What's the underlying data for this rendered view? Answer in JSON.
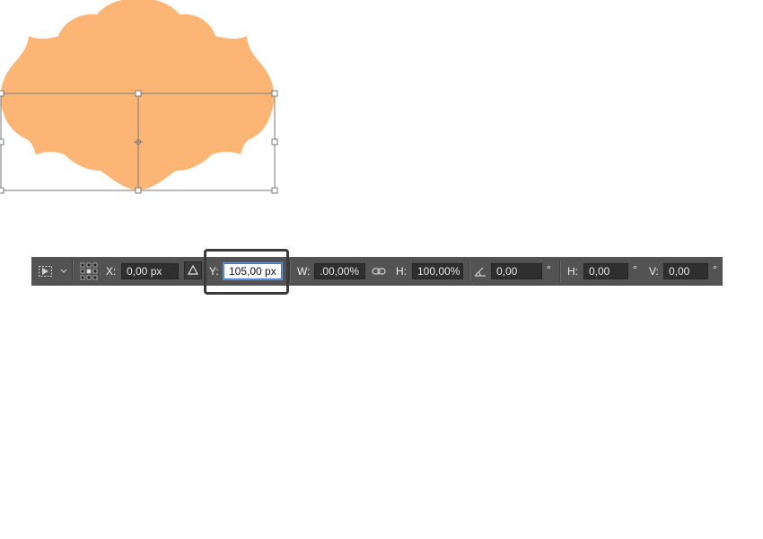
{
  "colors": {
    "shape_fill": "#FDB575",
    "bounding_box": "#7a7a7a",
    "toolbar_bg": "#535353",
    "field_bg": "#2f2f2f",
    "active_field_border": "#3b78c9"
  },
  "toolbar": {
    "tool_icon": "transform-tool-icon",
    "reference_point_icon": "reference-point-grid-icon",
    "x_label": "X:",
    "x_value": "0,00 px",
    "delta_icon": "relative-position-triangle-icon",
    "y_label": "Y:",
    "y_value": "105,00 px",
    "w_label": "W:",
    "w_value": ".00,00%",
    "link_icon": "maintain-aspect-ratio-link-icon",
    "h_label": "H:",
    "h_value": "100,00%",
    "angle_icon": "rotate-angle-icon",
    "angle_value": "0,00",
    "angle_unit": "°",
    "skew_h_label": "H:",
    "skew_h_value": "0,00",
    "skew_h_unit": "°",
    "skew_v_label": "V:",
    "skew_v_value": "0,00",
    "skew_v_unit": "°"
  }
}
